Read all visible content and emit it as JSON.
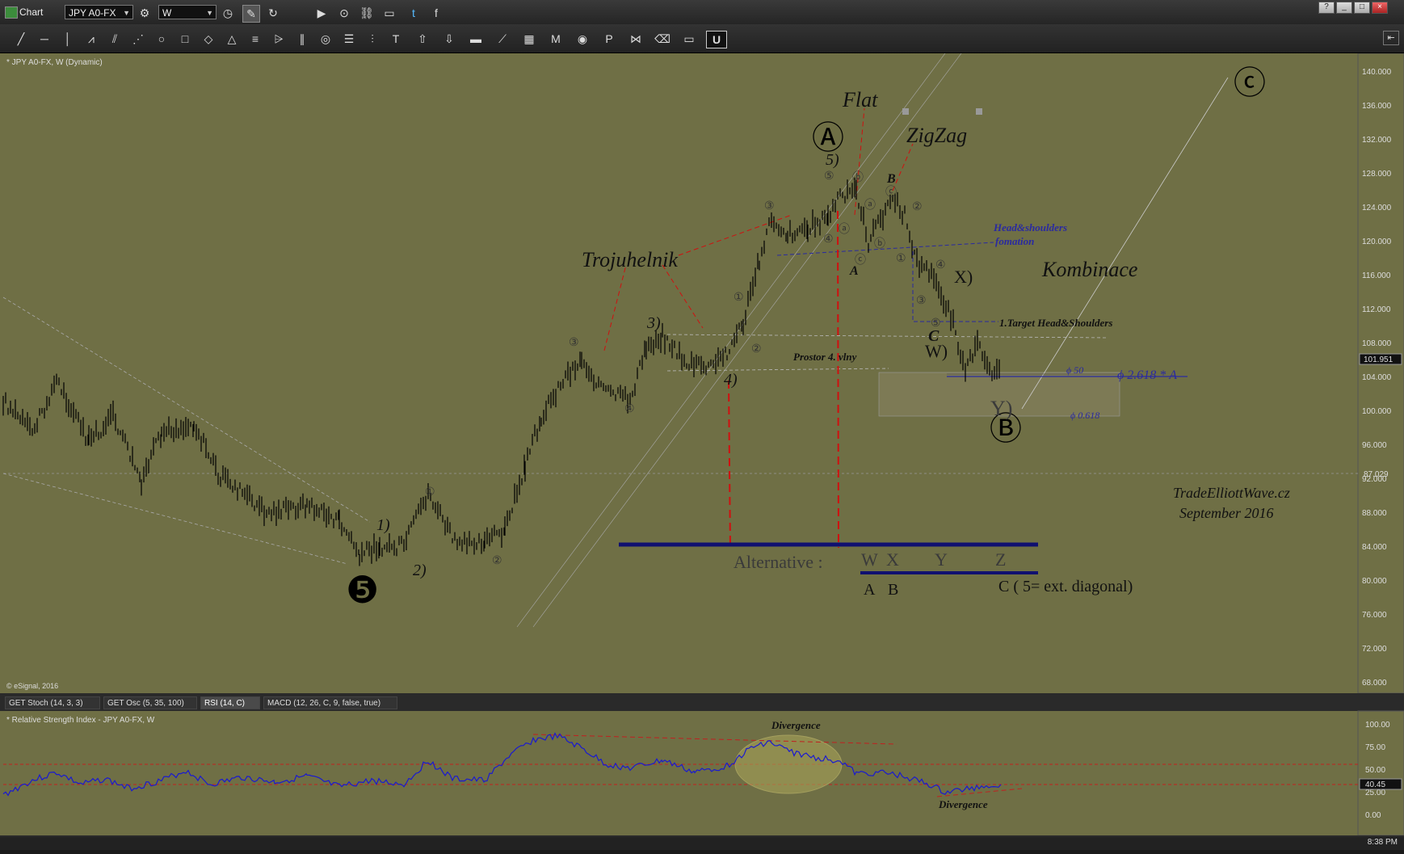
{
  "window": {
    "title": "Chart",
    "buttons": [
      "?",
      "_",
      "□",
      "×"
    ]
  },
  "toolbar": {
    "symbol": "JPY A0-FX",
    "interval": "W",
    "icons": [
      "settings-icon",
      "clock-icon",
      "pencil-icon",
      "refresh-icon",
      "play-icon",
      "mob-icon",
      "zoom-icon",
      "link-icon",
      "comment-icon",
      "twitter-icon",
      "facebook-icon"
    ]
  },
  "drawing_tools": {
    "tools": [
      "line-tool",
      "horizontal-line-tool",
      "vertical-line-tool",
      "wave-tool",
      "fib-tool",
      "fan-tool",
      "ellipse-tool",
      "rectangle-tool",
      "eraser-shape-tool",
      "triangle-tool",
      "channel-tool",
      "pitchfork-tool",
      "parallel-tool",
      "cycle-tool",
      "lines-tool",
      "bars-tool",
      "text-tool",
      "arrow-up-tool",
      "arrow-down-tool",
      "box-tool",
      "measure-tool",
      "grid-tool",
      "mob-tool",
      "eye-tool",
      "pti-tool",
      "pattern-tool",
      "eraser-tool",
      "comment-tool",
      "magnet-tool"
    ],
    "labels": {
      "mob": "MOB",
      "pti": "PTI",
      "text": "T",
      "magnet": "U"
    }
  },
  "chart": {
    "header": "* JPY A0-FX, W (Dynamic)",
    "copyright": "© eSignal, 2016",
    "last_price": "101.951",
    "line_price": "87.029",
    "price_axis": [
      "140.000",
      "136.000",
      "132.000",
      "128.000",
      "124.000",
      "120.000",
      "116.000",
      "112.000",
      "108.000",
      "104.000",
      "100.000",
      "96.000",
      "92.000",
      "88.000",
      "84.000",
      "80.000",
      "76.000",
      "72.000",
      "68.000"
    ],
    "annotations": {
      "flat": "Flat",
      "zigzag": "ZigZag",
      "wave_a_big": "Ⓐ",
      "wave_b_big": "Ⓑ",
      "wave_c_big": "ⓒ",
      "wave_5_big": "❺",
      "trojuhelnik": "Trojuhelnik",
      "kombinace": "Kombinace",
      "head_shoulders_1": "Head&shoulders",
      "head_shoulders_2": "fomation",
      "target": "1.Target Head&Shoulders",
      "prostor": "Prostor 4. vlny",
      "fib_50": "ϕ 50",
      "fib_2618": "ϕ 2.618 * A",
      "fib_0618": "ϕ 0.618",
      "alternative": "Alternative :",
      "alt_w": "W",
      "alt_x": "X",
      "alt_y": "Y",
      "alt_z": "Z",
      "alt_a": "A",
      "alt_b": "B",
      "alt_c": "C ( 5= ext. diagonal)",
      "brand": "TradeElliottWave.cz",
      "date": "September   2016",
      "w1": "1)",
      "w2": "2)",
      "w3": "3)",
      "w4": "4)",
      "w5": "5)",
      "wx": "X)",
      "ww": "W)",
      "wy": "Y)",
      "wc": "C",
      "wA": "A",
      "wB": "B"
    },
    "circled": {
      "c1": "①",
      "c2": "②",
      "c3": "③",
      "c4": "④",
      "c5": "⑤",
      "ca": "ⓐ",
      "cb": "ⓑ",
      "cc": "ⓒ"
    }
  },
  "panel_tabs": [
    {
      "label": "GET Stoch (14, 3, 3)",
      "active": false
    },
    {
      "label": "GET Osc (5, 35, 100)",
      "active": false
    },
    {
      "label": "RSI (14, C)",
      "active": true
    },
    {
      "label": "MACD (12, 26, C, 9, false, true)",
      "active": false
    }
  ],
  "rsi": {
    "header": "* Relative Strength Index - JPY A0-FX, W",
    "value": "40.45",
    "axis": [
      "100.00",
      "75.00",
      "50.00",
      "25.00",
      "0.00"
    ],
    "divergence_top": "Divergence",
    "divergence_bottom": "Divergence"
  },
  "statusbar": {
    "time": "8:38 PM"
  }
}
